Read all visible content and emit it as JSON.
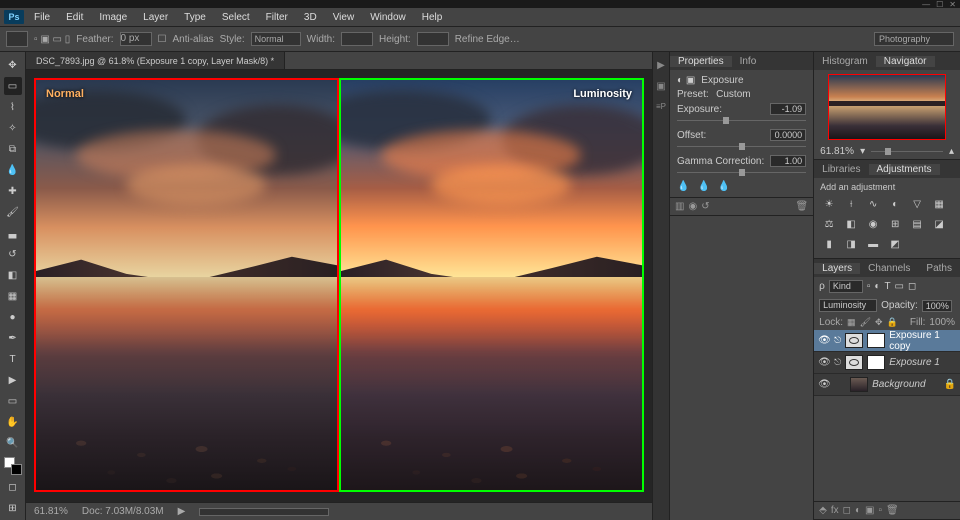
{
  "titlebar": {
    "min": "—",
    "max": "☐",
    "close": "✕"
  },
  "menu": [
    "File",
    "Edit",
    "Image",
    "Layer",
    "Type",
    "Select",
    "Filter",
    "3D",
    "View",
    "Window",
    "Help"
  ],
  "options": {
    "feather_label": "Feather:",
    "feather_value": "0 px",
    "anti_alias": "Anti-alias",
    "style_label": "Style:",
    "style_value": "Normal",
    "width_label": "Width:",
    "height_label": "Height:",
    "refine": "Refine Edge…",
    "workspace": "Photography"
  },
  "doc": {
    "tab": "DSC_7893.jpg @ 61.8% (Exposure 1 copy, Layer Mask/8) *"
  },
  "compare": {
    "left": "Normal",
    "right": "Luminosity"
  },
  "status": {
    "zoom": "61.81%",
    "doc": "Doc: 7.03M/8.03M"
  },
  "props": {
    "tabs": [
      "Properties",
      "Info"
    ],
    "title": "Exposure",
    "preset_label": "Preset:",
    "preset_value": "Custom",
    "exposure_label": "Exposure:",
    "exposure_value": "-1.09",
    "offset_label": "Offset:",
    "offset_value": "0.0000",
    "gamma_label": "Gamma Correction:",
    "gamma_value": "1.00"
  },
  "nav": {
    "tabs": [
      "Histogram",
      "Navigator"
    ],
    "zoom": "61.81%"
  },
  "adj": {
    "tabs": [
      "Libraries",
      "Adjustments"
    ],
    "title": "Add an adjustment"
  },
  "layers": {
    "tabs": [
      "Layers",
      "Channels",
      "Paths"
    ],
    "kind": "Kind",
    "blend": "Luminosity",
    "opacity_label": "Opacity:",
    "opacity": "100%",
    "lock_label": "Lock:",
    "fill_label": "Fill:",
    "fill": "100%",
    "items": [
      {
        "name": "Exposure 1 copy",
        "type": "adj"
      },
      {
        "name": "Exposure 1",
        "type": "adj"
      },
      {
        "name": "Background",
        "type": "img"
      }
    ]
  }
}
